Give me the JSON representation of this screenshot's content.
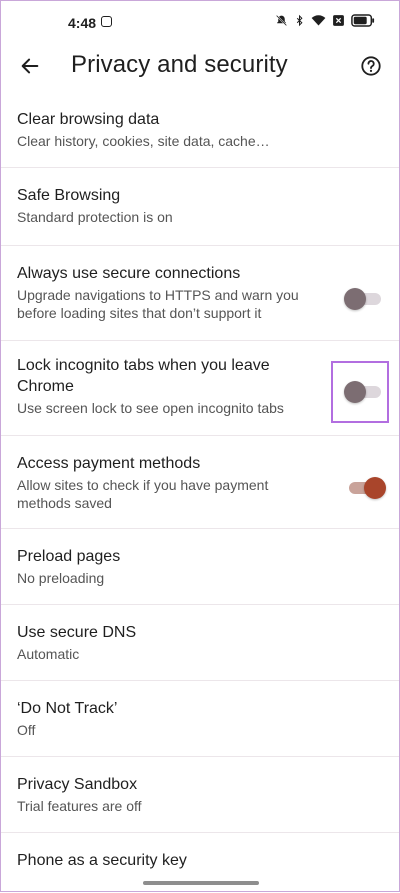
{
  "status_bar": {
    "time": "4:48",
    "icons": [
      "app-notification-icon",
      "mute-icon",
      "bluetooth-icon",
      "wifi-icon",
      "notification-x-icon",
      "battery-icon"
    ]
  },
  "app_bar": {
    "back_icon": "arrow-left-icon",
    "title": "Privacy and security",
    "help_icon": "help-circle-icon"
  },
  "colors": {
    "accent": "#a9452b",
    "highlight": "#b26ee0",
    "toggle_off_thumb": "#7c6d72"
  },
  "settings": [
    {
      "title": "Clear browsing data",
      "subtitle": "Clear history, cookies, site data, cache…"
    },
    {
      "title": "Safe Browsing",
      "subtitle": "Standard protection is on"
    },
    {
      "title": "Always use secure connections",
      "subtitle": "Upgrade navigations to HTTPS and warn you before loading sites that don’t support it",
      "toggle": "off"
    },
    {
      "title": "Lock incognito tabs when you leave Chrome",
      "subtitle": "Use screen lock to see open incognito tabs",
      "toggle": "off",
      "highlighted": true
    },
    {
      "title": "Access payment methods",
      "subtitle": "Allow sites to check if you have payment methods saved",
      "toggle": "on"
    },
    {
      "title": "Preload pages",
      "subtitle": "No preloading"
    },
    {
      "title": "Use secure DNS",
      "subtitle": "Automatic"
    },
    {
      "title": "‘Do Not Track’",
      "subtitle": "Off"
    },
    {
      "title": "Privacy Sandbox",
      "subtitle": "Trial features are off"
    },
    {
      "title": "Phone as a security key",
      "subtitle": ""
    }
  ]
}
